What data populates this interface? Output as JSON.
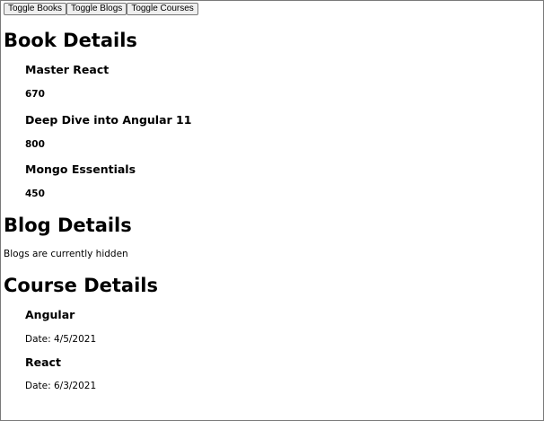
{
  "toolbar": {
    "toggle_books": "Toggle Books",
    "toggle_blogs": "Toggle Blogs",
    "toggle_courses": "Toggle Courses"
  },
  "books": {
    "heading": "Book Details",
    "items": [
      {
        "name": "Master React",
        "price": "670"
      },
      {
        "name": "Deep Dive into Angular 11",
        "price": "800"
      },
      {
        "name": "Mongo Essentials",
        "price": "450"
      }
    ]
  },
  "blogs": {
    "heading": "Blog Details",
    "message": "Blogs are currently hidden"
  },
  "courses": {
    "heading": "Course Details",
    "items": [
      {
        "name": "Angular",
        "date": "Date: 4/5/2021"
      },
      {
        "name": "React",
        "date": "Date: 6/3/2021"
      }
    ]
  }
}
